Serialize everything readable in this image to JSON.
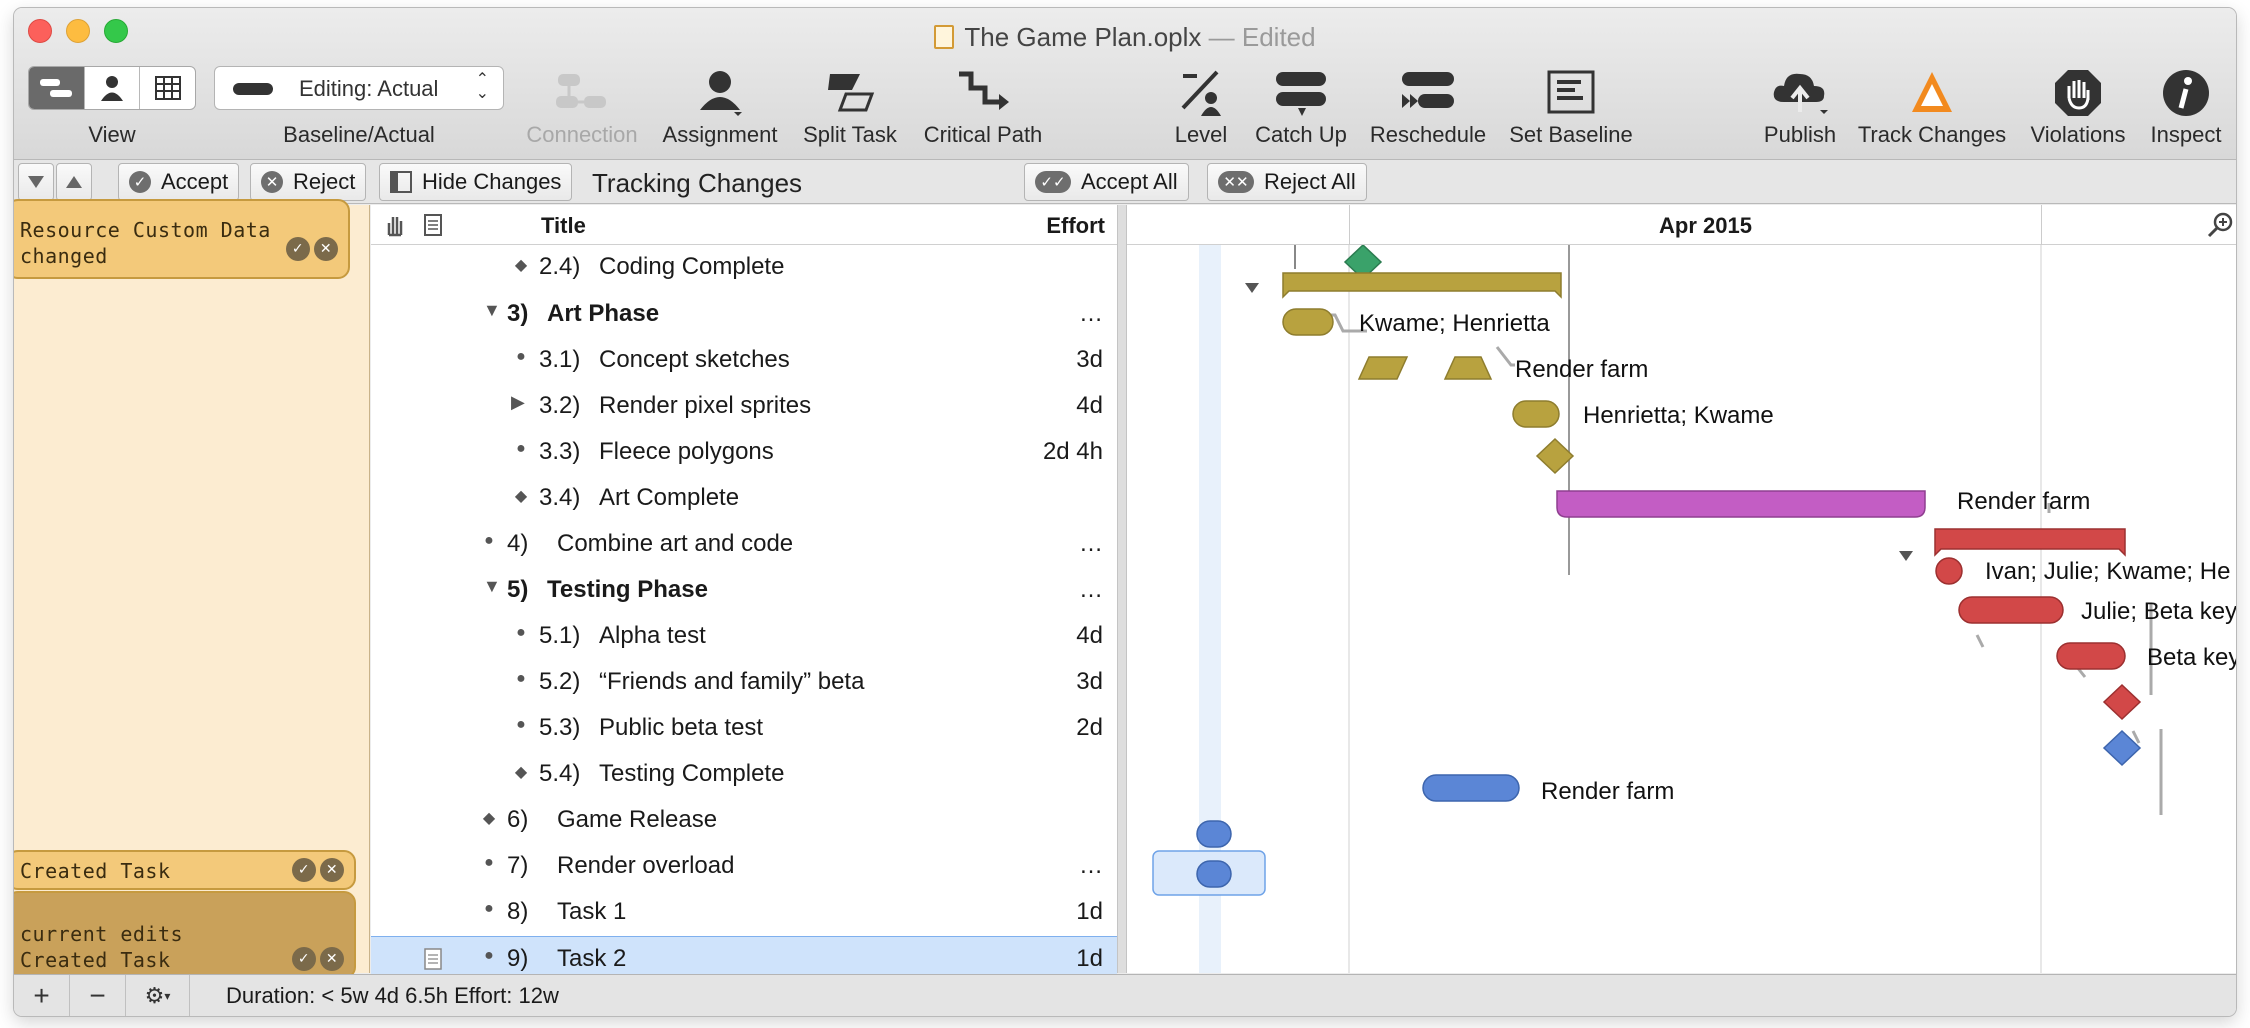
{
  "window": {
    "filename": "The Game Plan.oplx",
    "state": "Edited"
  },
  "toolbar": {
    "view_label": "View",
    "baseline_value": "Editing: Actual",
    "baseline_label": "Baseline/Actual",
    "connection": "Connection",
    "assignment": "Assignment",
    "split_task": "Split Task",
    "critical_path": "Critical Path",
    "level": "Level",
    "catch_up": "Catch Up",
    "reschedule": "Reschedule",
    "set_baseline": "Set Baseline",
    "publish": "Publish",
    "track_changes": "Track Changes",
    "violations": "Violations",
    "inspect": "Inspect"
  },
  "changebar": {
    "accept": "Accept",
    "reject": "Reject",
    "hide_changes": "Hide Changes",
    "title": "Tracking Changes",
    "accept_all": "Accept All",
    "reject_all": "Reject All"
  },
  "notes": {
    "resource": "Resource Custom Data changed",
    "created1": "Created Task",
    "created2_line1": "current edits",
    "created2_line2": "Created Task"
  },
  "outline": {
    "col_title": "Title",
    "col_effort": "Effort",
    "rows": [
      {
        "num": "2.4)",
        "name": "Coding Complete",
        "effort": ""
      },
      {
        "num": "3)",
        "name": "Art Phase",
        "effort": "…"
      },
      {
        "num": "3.1)",
        "name": "Concept sketches",
        "effort": "3d"
      },
      {
        "num": "3.2)",
        "name": "Render pixel sprites",
        "effort": "4d"
      },
      {
        "num": "3.3)",
        "name": "Fleece polygons",
        "effort": "2d 4h"
      },
      {
        "num": "3.4)",
        "name": "Art Complete",
        "effort": ""
      },
      {
        "num": "4)",
        "name": "Combine art and code",
        "effort": "…"
      },
      {
        "num": "5)",
        "name": "Testing Phase",
        "effort": "…"
      },
      {
        "num": "5.1)",
        "name": "Alpha test",
        "effort": "4d"
      },
      {
        "num": "5.2)",
        "name": "“Friends and family” beta",
        "effort": "3d"
      },
      {
        "num": "5.3)",
        "name": "Public beta test",
        "effort": "2d"
      },
      {
        "num": "5.4)",
        "name": "Testing Complete",
        "effort": ""
      },
      {
        "num": "6)",
        "name": "Game Release",
        "effort": ""
      },
      {
        "num": "7)",
        "name": "Render overload",
        "effort": "…"
      },
      {
        "num": "8)",
        "name": "Task 1",
        "effort": "1d"
      },
      {
        "num": "9)",
        "name": "Task 2",
        "effort": "1d"
      }
    ]
  },
  "gantt": {
    "month": "Apr 2015",
    "labels": {
      "concept": "Kwame; Henrietta",
      "render": "Render farm",
      "fleece": "Henrietta; Kwame",
      "combine": "Render farm",
      "alpha": "Ivan; Julie; Kwame; He",
      "friends": "Julie; Beta key",
      "public": "Beta keys",
      "overload": "Render farm"
    },
    "colors": {
      "art": "#b8a23f",
      "combine": "#c35dc4",
      "testing": "#d24848",
      "blue": "#5b86d6",
      "green": "#3aa26a"
    }
  },
  "statusbar": {
    "summary": "Duration: < 5w 4d 6.5h Effort: 12w"
  }
}
